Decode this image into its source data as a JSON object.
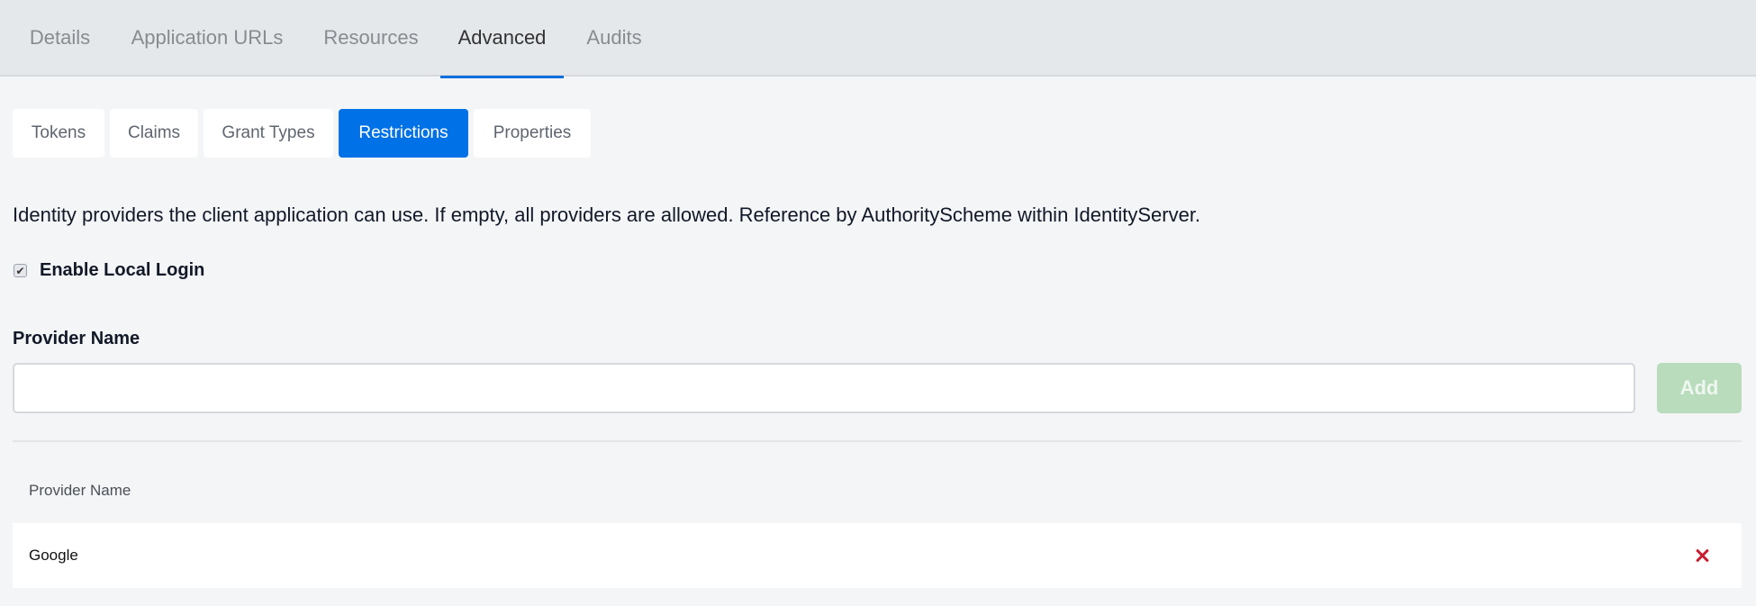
{
  "top_tabs": [
    {
      "label": "Details",
      "active": false
    },
    {
      "label": "Application URLs",
      "active": false
    },
    {
      "label": "Resources",
      "active": false
    },
    {
      "label": "Advanced",
      "active": true
    },
    {
      "label": "Audits",
      "active": false
    }
  ],
  "sub_tabs": [
    {
      "label": "Tokens",
      "active": false
    },
    {
      "label": "Claims",
      "active": false
    },
    {
      "label": "Grant Types",
      "active": false
    },
    {
      "label": "Restrictions",
      "active": true
    },
    {
      "label": "Properties",
      "active": false
    }
  ],
  "restrictions": {
    "description": "Identity providers the client application can use. If empty, all providers are allowed. Reference by AuthorityScheme within IdentityServer.",
    "enable_local_login": {
      "label": "Enable Local Login",
      "checked": true
    },
    "provider_name_label": "Provider Name",
    "provider_name_value": "",
    "provider_name_placeholder": "",
    "add_button_label": "Add",
    "table": {
      "columns": [
        "Provider Name"
      ],
      "rows": [
        {
          "name": "Google",
          "action_icon": "delete-icon"
        }
      ]
    }
  },
  "colors": {
    "accent": "#0071e6",
    "add_button_disabled": "#b8dcbc",
    "delete": "#c81e2f"
  }
}
